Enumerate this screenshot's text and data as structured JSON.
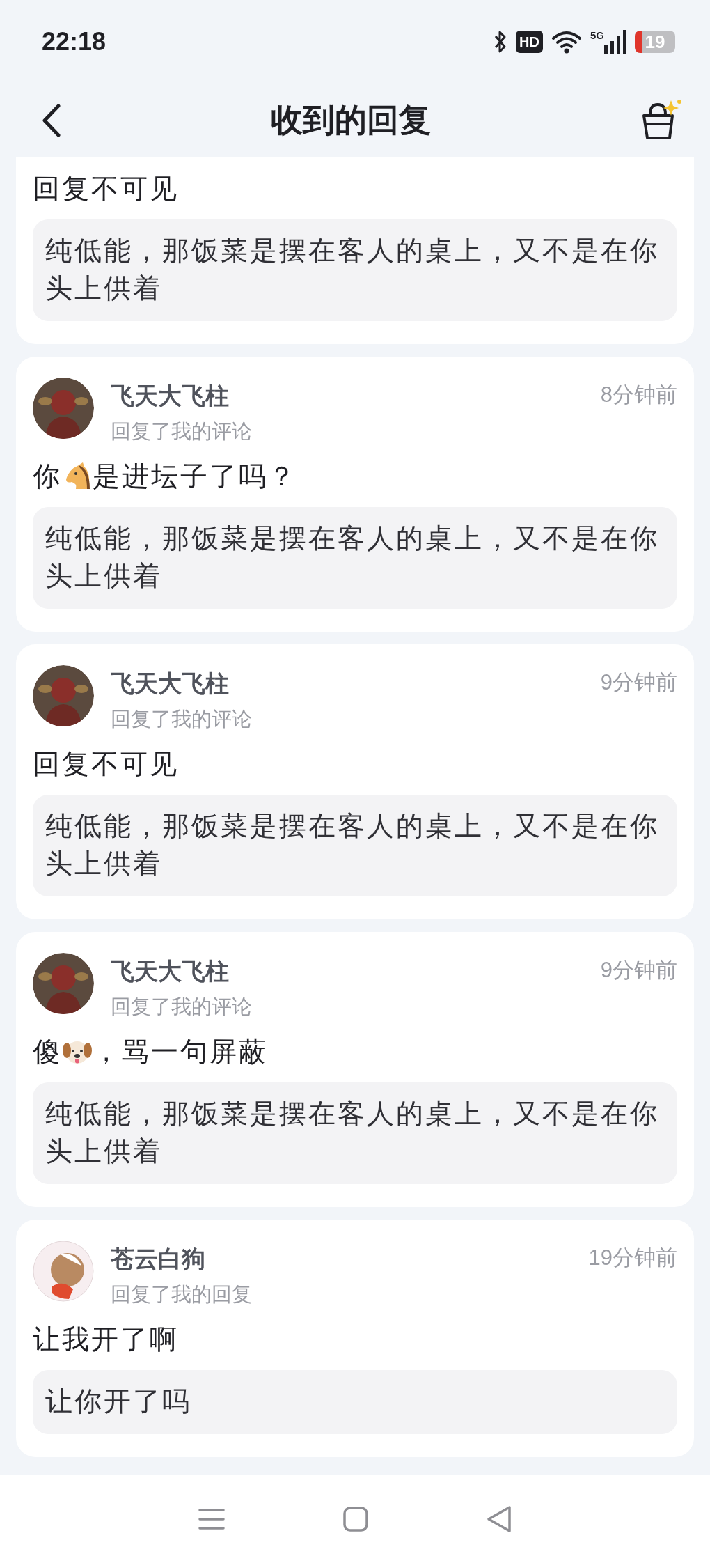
{
  "status_bar": {
    "time": "22:18",
    "hd_badge": "HD",
    "network": "5G",
    "battery": "19"
  },
  "header": {
    "title": "收到的回复"
  },
  "replies": [
    {
      "body": [
        {
          "kind": "text",
          "text": "回复不可见"
        }
      ],
      "quote": "纯低能，那饭菜是摆在客人的桌上，又不是在你头上供着"
    },
    {
      "avatar": {
        "kind": "dark"
      },
      "name": "飞天大飞柱",
      "action": "回复了我的评论",
      "time": "8分钟前",
      "body": [
        {
          "kind": "text",
          "text": "你"
        },
        {
          "kind": "horse"
        },
        {
          "kind": "text",
          "text": "是进坛子了吗？"
        }
      ],
      "quote": "纯低能，那饭菜是摆在客人的桌上，又不是在你头上供着"
    },
    {
      "avatar": {
        "kind": "dark"
      },
      "name": "飞天大飞柱",
      "action": "回复了我的评论",
      "time": "9分钟前",
      "body": [
        {
          "kind": "text",
          "text": "回复不可见"
        }
      ],
      "quote": "纯低能，那饭菜是摆在客人的桌上，又不是在你头上供着"
    },
    {
      "avatar": {
        "kind": "dark"
      },
      "name": "飞天大飞柱",
      "action": "回复了我的评论",
      "time": "9分钟前",
      "body": [
        {
          "kind": "text",
          "text": "傻"
        },
        {
          "kind": "dog"
        },
        {
          "kind": "text",
          "text": "，骂一句屏蔽"
        }
      ],
      "quote": "纯低能，那饭菜是摆在客人的桌上，又不是在你头上供着"
    },
    {
      "avatar": {
        "kind": "light"
      },
      "name": "苍云白狗",
      "action": "回复了我的回复",
      "time": "19分钟前",
      "body": [
        {
          "kind": "text",
          "text": "让我开了啊"
        }
      ],
      "quote": "让你开了吗"
    }
  ]
}
